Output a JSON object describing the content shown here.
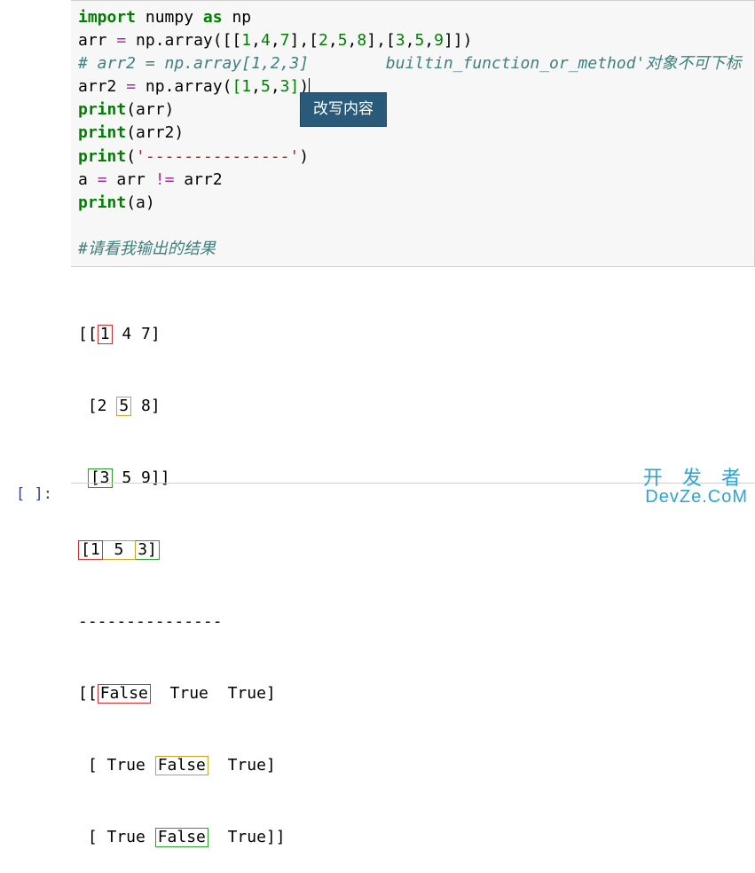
{
  "code": {
    "l1": {
      "kw1": "import",
      "mod": "numpy",
      "kw2": "as",
      "alias": "np"
    },
    "l2": {
      "var": "arr",
      "eq": "=",
      "call": "np.array",
      "args": "([[1,4,7],[2,5,8],[3,5,9]])"
    },
    "l3": {
      "comment_a": "# arr2 = np.array[1,2,3]",
      "comment_b": "builtin_function_or_method'对象不可下标"
    },
    "l4": {
      "var": "arr2",
      "eq": "=",
      "call": "np.array",
      "args": "([1,5,3])"
    },
    "l5": {
      "fn": "print",
      "arg": "(arr)"
    },
    "l6": {
      "fn": "print",
      "arg": "(arr2)"
    },
    "l7": {
      "fn": "print",
      "open": "(",
      "str": "'---------------'",
      "close": ")"
    },
    "l8": {
      "lhs": "a",
      "eq": "=",
      "e1": "arr",
      "op": "!=",
      "e2": "arr2"
    },
    "l9": {
      "fn": "print",
      "arg": "(a)"
    },
    "l10": {
      "blank": ""
    },
    "l11": {
      "comment": "#请看我输出的结果"
    }
  },
  "tooltip": {
    "label": "改写内容"
  },
  "output": {
    "r1": {
      "pre": "[[",
      "a": "1",
      "mid": " 4 7]"
    },
    "r2": {
      "pre": " [2 ",
      "a": "5",
      "post": " 8]"
    },
    "r3": {
      "pre": " ",
      "a": "[3",
      "post": " 5 9]]"
    },
    "r4": {
      "a": "[1",
      "b": " 5 ",
      "c": "3]"
    },
    "r5": "---------------",
    "r6": {
      "pre": "[[",
      "a": "False",
      "post": "  True  True]"
    },
    "r7": {
      "pre": " [ True ",
      "a": "False",
      "post": "  True]"
    },
    "r8": {
      "pre": " [ True ",
      "a": "False",
      "post": "  True]]"
    }
  },
  "prompt": "[ ]:",
  "watermark": {
    "line1": "开 发 者",
    "line2": "DevZe.CoM"
  }
}
